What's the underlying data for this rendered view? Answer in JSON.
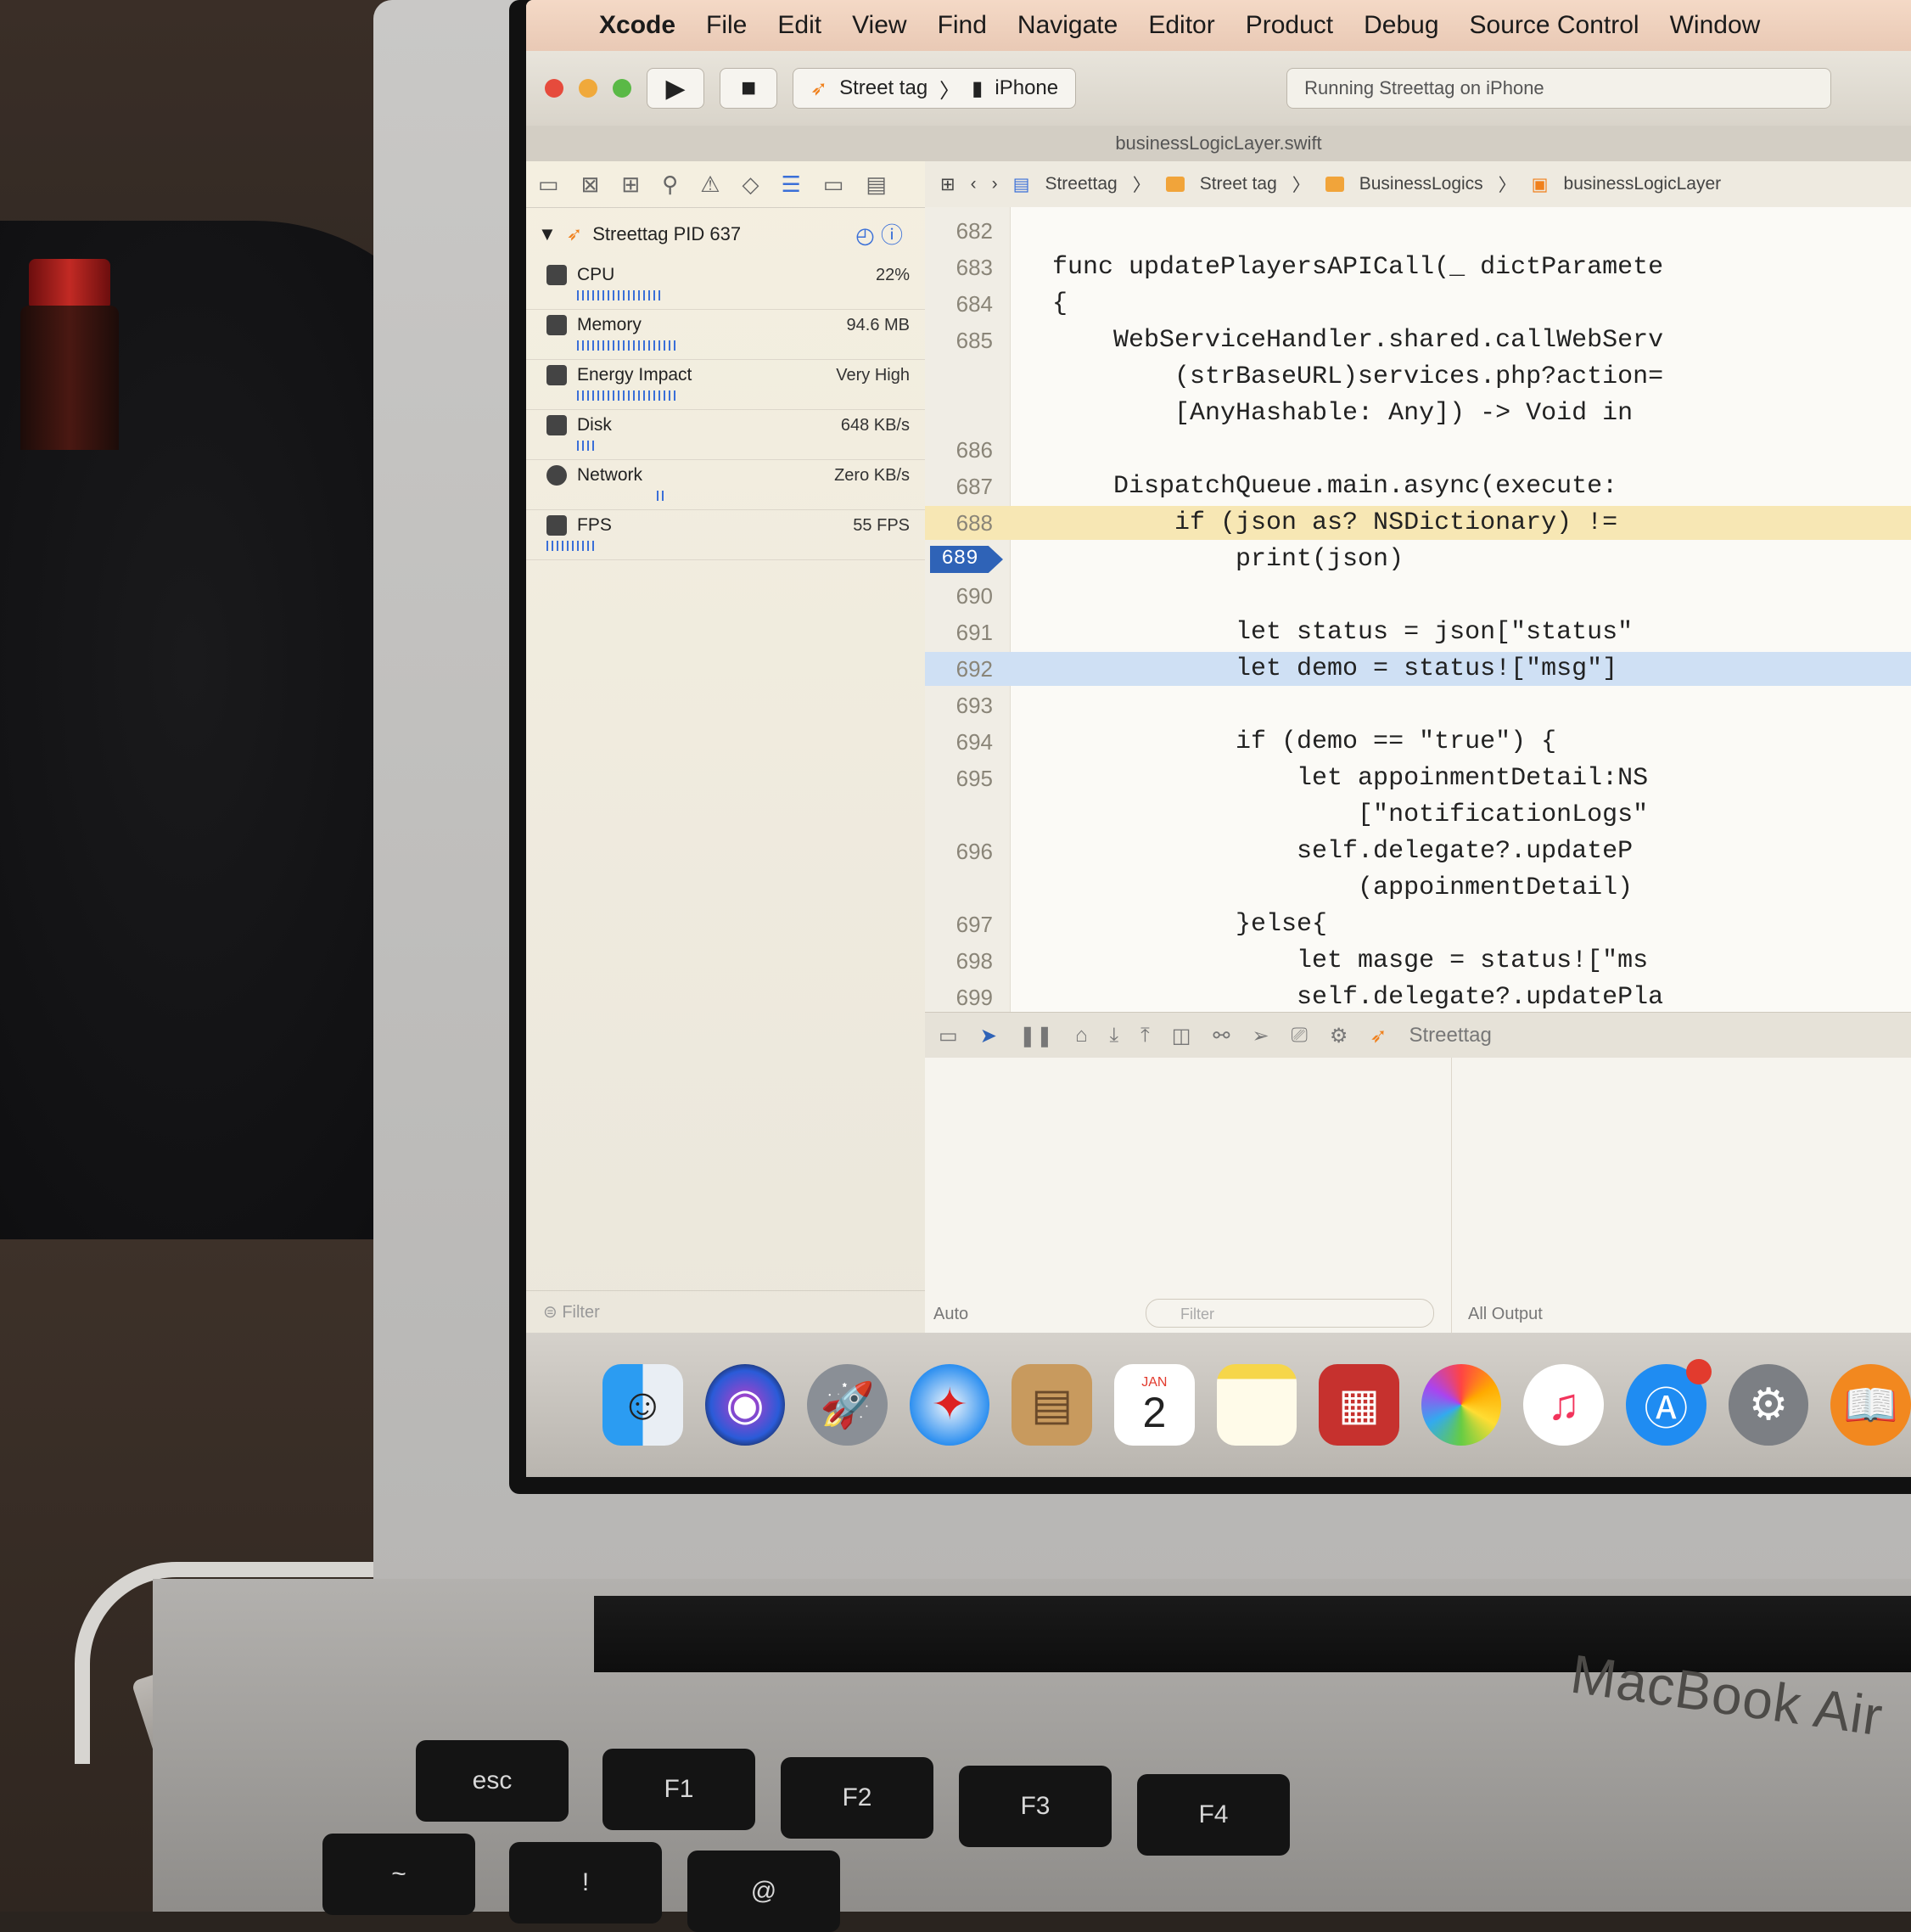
{
  "menubar": {
    "app_name": "Xcode",
    "items": [
      "File",
      "Edit",
      "View",
      "Find",
      "Navigate",
      "Editor",
      "Product",
      "Debug",
      "Source Control",
      "Window"
    ]
  },
  "toolbar": {
    "scheme": "Street tag",
    "device": "iPhone",
    "status": "Running Streettag on iPhone"
  },
  "file_tab": "businessLogicLayer.swift",
  "navigator": {
    "process": "Streettag PID 637",
    "gauges": [
      {
        "label": "CPU",
        "value": "22%"
      },
      {
        "label": "Memory",
        "value": "94.6 MB"
      },
      {
        "label": "Energy Impact",
        "value": "Very High"
      },
      {
        "label": "Disk",
        "value": "648 KB/s"
      },
      {
        "label": "Network",
        "value": "Zero KB/s"
      },
      {
        "label": "FPS",
        "value": "55 FPS"
      }
    ],
    "filter": "Filter"
  },
  "jumpbar": [
    "Streettag",
    "Street tag",
    "BusinessLogics",
    "businessLogicLayer"
  ],
  "code_lines": [
    {
      "num": "682",
      "code": ""
    },
    {
      "num": "683",
      "code": "func updatePlayersAPICall(_ dictParamete"
    },
    {
      "num": "684",
      "code": "{"
    },
    {
      "num": "685",
      "code": "    WebServiceHandler.shared.callWebServ"
    },
    {
      "num": "",
      "code": "        (strBaseURL)services.php?action="
    },
    {
      "num": "",
      "code": "        [AnyHashable: Any]) -> Void in"
    },
    {
      "num": "686",
      "code": ""
    },
    {
      "num": "687",
      "code": "    DispatchQueue.main.async(execute:"
    },
    {
      "num": "688",
      "code": "        if (json as? NSDictionary) !="
    },
    {
      "num": "689",
      "code": "            print(json)"
    },
    {
      "num": "690",
      "code": ""
    },
    {
      "num": "691",
      "code": "            let status = json[\"status\""
    },
    {
      "num": "692",
      "code": "            let demo = status![\"msg\"]"
    },
    {
      "num": "693",
      "code": ""
    },
    {
      "num": "694",
      "code": "            if (demo == \"true\") {"
    },
    {
      "num": "695",
      "code": "                let appoinmentDetail:NS"
    },
    {
      "num": "",
      "code": "                    [\"notificationLogs\""
    },
    {
      "num": "696",
      "code": "                self.delegate?.updateP"
    },
    {
      "num": "",
      "code": "                    (appoinmentDetail)"
    },
    {
      "num": "697",
      "code": "            }else{"
    },
    {
      "num": "698",
      "code": "                let masge = status![\"ms"
    },
    {
      "num": "699",
      "code": "                self.delegate?.updatePla"
    }
  ],
  "debug": {
    "target": "Streettag",
    "auto_label": "Auto",
    "filter_placeholder": "Filter",
    "output_label": "All Output"
  },
  "dock": {
    "calendar_month": "JAN",
    "calendar_day": "2",
    "appstore_badge": ""
  },
  "keyboard": {
    "esc": "esc",
    "f1": "F1",
    "f2": "F2",
    "f3": "F3",
    "f4": "F4",
    "tilde": "~",
    "exclaim": "!",
    "at": "@"
  },
  "brand": "MacBook Air"
}
